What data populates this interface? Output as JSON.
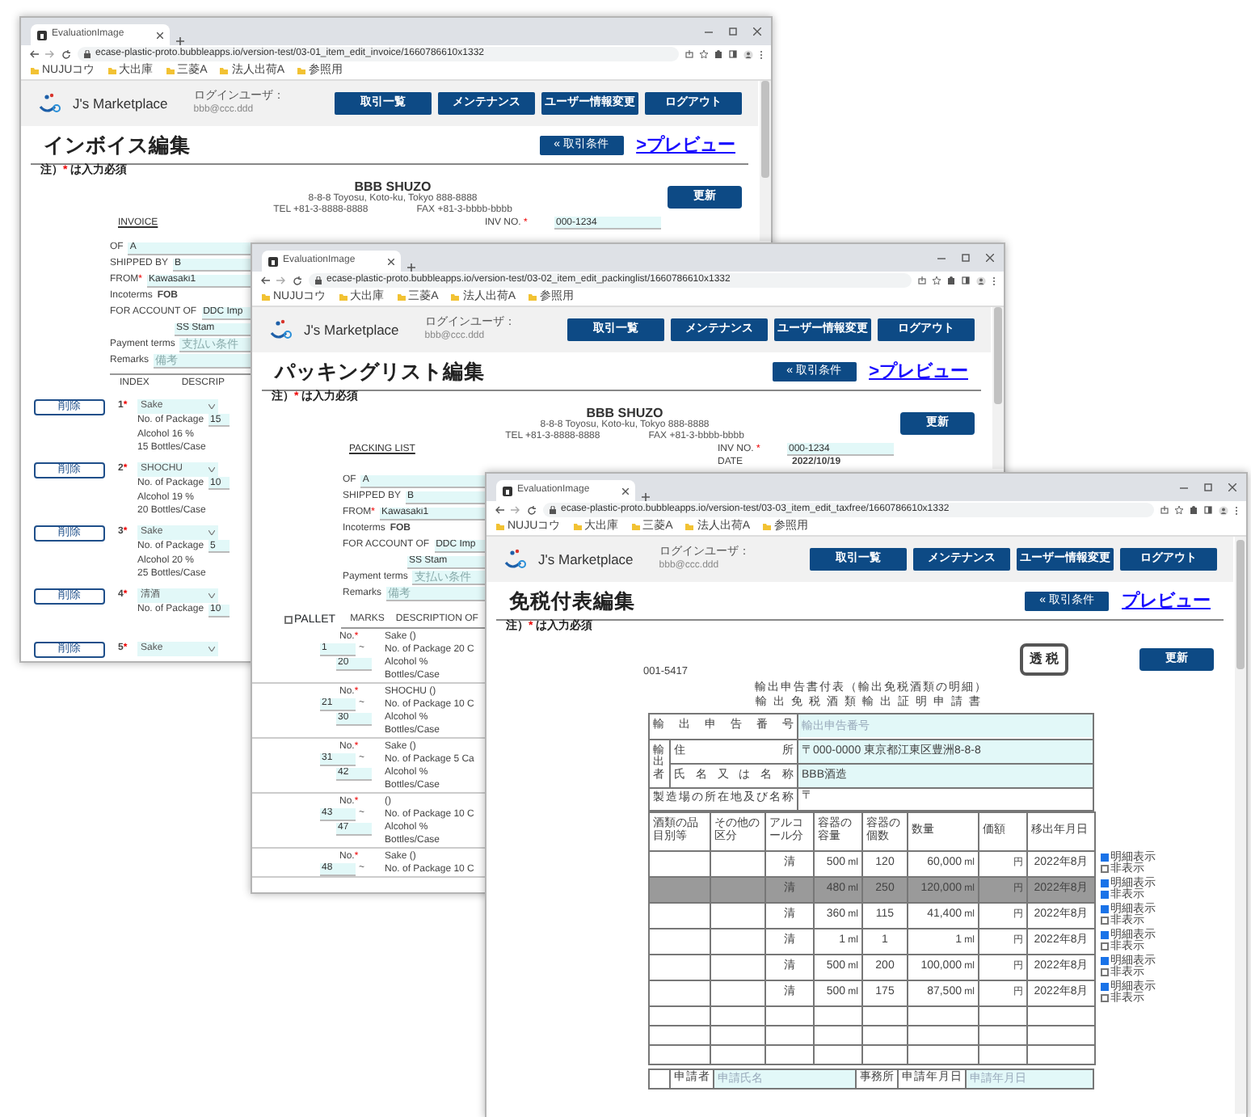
{
  "required_mark": "*",
  "range_separator": "~",
  "windows": [
    {
      "kind": "invoice",
      "tab_title": "EvaluationImage",
      "url": "ecase-plastic-proto.bubbleapps.io/version-test/03-01_item_edit_invoice/1660786610x1332",
      "bookmarks": [
        "NUJUコウ",
        "大出庫",
        "三菱A",
        "法人出荷A",
        "参照用"
      ],
      "brand": "J's Marketplace",
      "login_label": "ログインユーザ：",
      "login_user": "bbb@ccc.ddd",
      "nav_buttons": [
        "取引一覧",
        "メンテナンス",
        "ユーザー情報変更",
        "ログアウト"
      ],
      "title": "インボイス編集",
      "back_button": "« 取引条件",
      "preview_link": ">プレビュー",
      "note_prefix": "注）",
      "note_text": "は入力必須",
      "update_button": "更新",
      "company": {
        "name": "BBB SHUZO",
        "address": "8-8-8 Toyosu, Koto-ku, Tokyo 888-8888",
        "tel": "TEL +81-3-8888-8888",
        "fax": "FAX +81-3-bbbb-bbbb"
      },
      "doc_label": "INVOICE",
      "inv_no_label": "INV NO.",
      "inv_no": "000-1234",
      "form": [
        {
          "kind": "input",
          "label": "OF",
          "value": "A"
        },
        {
          "kind": "input",
          "label": "SHIPPED BY",
          "value": "B"
        },
        {
          "kind": "input",
          "label": "FROM",
          "required": true,
          "value": "Kawasaki1"
        },
        {
          "kind": "text",
          "label": "Incoterms",
          "value": "FOB"
        },
        {
          "kind": "input",
          "label": "FOR ACCOUNT OF",
          "value": "DDC Imp"
        },
        {
          "kind": "input",
          "value": "SS Stam"
        },
        {
          "kind": "input",
          "label": "Payment terms",
          "placeholder": "支払い条件"
        },
        {
          "kind": "input",
          "label": "Remarks",
          "placeholder": "備考"
        }
      ],
      "columns": [
        "INDEX",
        "DESCRIP"
      ],
      "items": [
        {
          "delete_button": "削除",
          "index": "1",
          "product": "Sake",
          "package_label": "No. of Package",
          "package": "15",
          "lines": [
            "Alcohol 16 %",
            "15 Bottles/Case"
          ]
        },
        {
          "delete_button": "削除",
          "index": "2",
          "product": "SHOCHU",
          "package_label": "No. of Package",
          "package": "10",
          "lines": [
            "Alcohol 19 %",
            "20 Bottles/Case"
          ]
        },
        {
          "delete_button": "削除",
          "index": "3",
          "product": "Sake",
          "package_label": "No. of Package",
          "package": "5",
          "lines": [
            "Alcohol 20 %",
            "25 Bottles/Case"
          ]
        },
        {
          "delete_button": "削除",
          "index": "4",
          "product": "清酒",
          "package_label": "No. of Package",
          "package": "10"
        },
        {
          "delete_button": "削除",
          "index": "5",
          "product": "Sake"
        }
      ]
    },
    {
      "kind": "packing",
      "tab_title": "EvaluationImage",
      "url": "ecase-plastic-proto.bubbleapps.io/version-test/03-02_item_edit_packinglist/1660786610x1332",
      "bookmarks": [
        "NUJUコウ",
        "大出庫",
        "三菱A",
        "法人出荷A",
        "参照用"
      ],
      "brand": "J's Marketplace",
      "login_label": "ログインユーザ：",
      "login_user": "bbb@ccc.ddd",
      "nav_buttons": [
        "取引一覧",
        "メンテナンス",
        "ユーザー情報変更",
        "ログアウト"
      ],
      "title": "パッキングリスト編集",
      "back_button": "« 取引条件",
      "preview_link": ">プレビュー",
      "note_prefix": "注）",
      "note_text": "は入力必須",
      "update_button": "更新",
      "company": {
        "name": "BBB SHUZO",
        "address": "8-8-8 Toyosu, Koto-ku, Tokyo 888-8888",
        "tel": "TEL +81-3-8888-8888",
        "fax": "FAX +81-3-bbbb-bbbb"
      },
      "doc_label": "PACKING LIST",
      "inv_no_label": "INV NO.",
      "inv_no": "000-1234",
      "date_label": "DATE",
      "date": "2022/10/19",
      "form": [
        {
          "kind": "input",
          "label": "OF",
          "value": "A"
        },
        {
          "kind": "input",
          "label": "SHIPPED BY",
          "value": "B"
        },
        {
          "kind": "input",
          "label": "FROM",
          "required": true,
          "value": "Kawasaki1"
        },
        {
          "kind": "text",
          "label": "Incoterms",
          "value": "FOB"
        },
        {
          "kind": "input",
          "label": "FOR ACCOUNT OF",
          "value": "DDC Imp"
        },
        {
          "kind": "input",
          "value": "SS Stam"
        },
        {
          "kind": "input",
          "label": "Payment terms",
          "placeholder": "支払い条件"
        },
        {
          "kind": "input",
          "label": "Remarks",
          "placeholder": "備考"
        }
      ],
      "pallet": {
        "label": "PALLET",
        "checked": false
      },
      "columns": [
        "MARKS",
        "DESCRIPTION OF"
      ],
      "marks": [
        {
          "no_label": "No.",
          "from": "1",
          "to": "20",
          "product": "Sake ()",
          "package": "No. of Package 20 C",
          "alcohol": "Alcohol %",
          "case": "Bottles/Case"
        },
        {
          "no_label": "No.",
          "from": "21",
          "to": "30",
          "product": "SHOCHU ()",
          "package": "No. of Package 10 C",
          "alcohol": "Alcohol %",
          "case": "Bottles/Case"
        },
        {
          "no_label": "No.",
          "from": "31",
          "to": "42",
          "product": "Sake ()",
          "package": "No. of Package 5 Ca",
          "alcohol": "Alcohol %",
          "case": "Bottles/Case"
        },
        {
          "no_label": "No.",
          "from": "43",
          "to": "47",
          "product": "()",
          "package": "No. of Package 10 C",
          "alcohol": "Alcohol %",
          "case": "Bottles/Case"
        },
        {
          "no_label": "No.",
          "from": "48",
          "product": "Sake ()",
          "package": "No. of Package 10 C"
        }
      ]
    },
    {
      "kind": "taxfree",
      "tab_title": "EvaluationImage",
      "url": "ecase-plastic-proto.bubbleapps.io/version-test/03-03_item_edit_taxfree/1660786610x1332",
      "bookmarks": [
        "NUJUコウ",
        "大出庫",
        "三菱A",
        "法人出荷A",
        "参照用"
      ],
      "brand": "J's Marketplace",
      "login_label": "ログインユーザ：",
      "login_user": "bbb@ccc.ddd",
      "nav_buttons": [
        "取引一覧",
        "メンテナンス",
        "ユーザー情報変更",
        "ログアウト"
      ],
      "title": "免税付表編集",
      "back_button": "« 取引条件",
      "preview_link": "プレビュー",
      "note_prefix": "注）",
      "note_text": "は入力必須",
      "update_button": "更新",
      "code": "001-5417",
      "stamp": "透 税",
      "heading": "輸出申告書付表（輸出免税酒類の明細）",
      "subheading": "輸出免税酒類輸出証明申請書",
      "declaration": {
        "label": "輸出申告番号",
        "placeholder": "輸出申告番号"
      },
      "exporter": {
        "group_label": "輸出者",
        "address_label": "住所",
        "address": "〒000-0000 東京都江東区豊洲8-8-8",
        "name_label": "氏名又は名称",
        "name": "BBB酒造"
      },
      "factory": {
        "label": "製造場の所在地及び名称",
        "value": "〒"
      },
      "columns": [
        "酒類の品目別等",
        "その他の区分",
        "アルコール分",
        "容器の容量",
        "容器の個数",
        "数量",
        "価額",
        "移出年月日"
      ],
      "rows": [
        {
          "type": "清",
          "capacity": "500",
          "capacity_unit": "ml",
          "count": "120",
          "quantity": "60,000",
          "quantity_unit": "ml",
          "price_unit": "円",
          "date": "2022年8月",
          "detail_label": "明細表示",
          "detail": true,
          "hide_label": "非表示",
          "hidden": false
        },
        {
          "type": "清",
          "capacity": "480",
          "capacity_unit": "ml",
          "count": "250",
          "quantity": "120,000",
          "quantity_unit": "ml",
          "price_unit": "円",
          "date": "2022年8月",
          "detail_label": "明細表示",
          "detail": true,
          "hide_label": "非表示",
          "hidden": true
        },
        {
          "type": "清",
          "capacity": "360",
          "capacity_unit": "ml",
          "count": "115",
          "quantity": "41,400",
          "quantity_unit": "ml",
          "price_unit": "円",
          "date": "2022年8月",
          "detail_label": "明細表示",
          "detail": true,
          "hide_label": "非表示",
          "hidden": false
        },
        {
          "type": "清",
          "capacity": "1",
          "capacity_unit": "ml",
          "count": "1",
          "quantity": "1",
          "quantity_unit": "ml",
          "price_unit": "円",
          "date": "2022年8月",
          "detail_label": "明細表示",
          "detail": true,
          "hide_label": "非表示",
          "hidden": false
        },
        {
          "type": "清",
          "capacity": "500",
          "capacity_unit": "ml",
          "count": "200",
          "quantity": "100,000",
          "quantity_unit": "ml",
          "price_unit": "円",
          "date": "2022年8月",
          "detail_label": "明細表示",
          "detail": true,
          "hide_label": "非表示",
          "hidden": false
        },
        {
          "type": "清",
          "capacity": "500",
          "capacity_unit": "ml",
          "count": "175",
          "quantity": "87,500",
          "quantity_unit": "ml",
          "price_unit": "円",
          "date": "2022年8月",
          "detail_label": "明細表示",
          "detail": true,
          "hide_label": "非表示",
          "hidden": false
        }
      ],
      "applicant": {
        "label": "申請者",
        "name_placeholder": "申請氏名",
        "office": "事務所",
        "date_label": "申請年月日",
        "date_placeholder": "申請年月日"
      }
    }
  ]
}
